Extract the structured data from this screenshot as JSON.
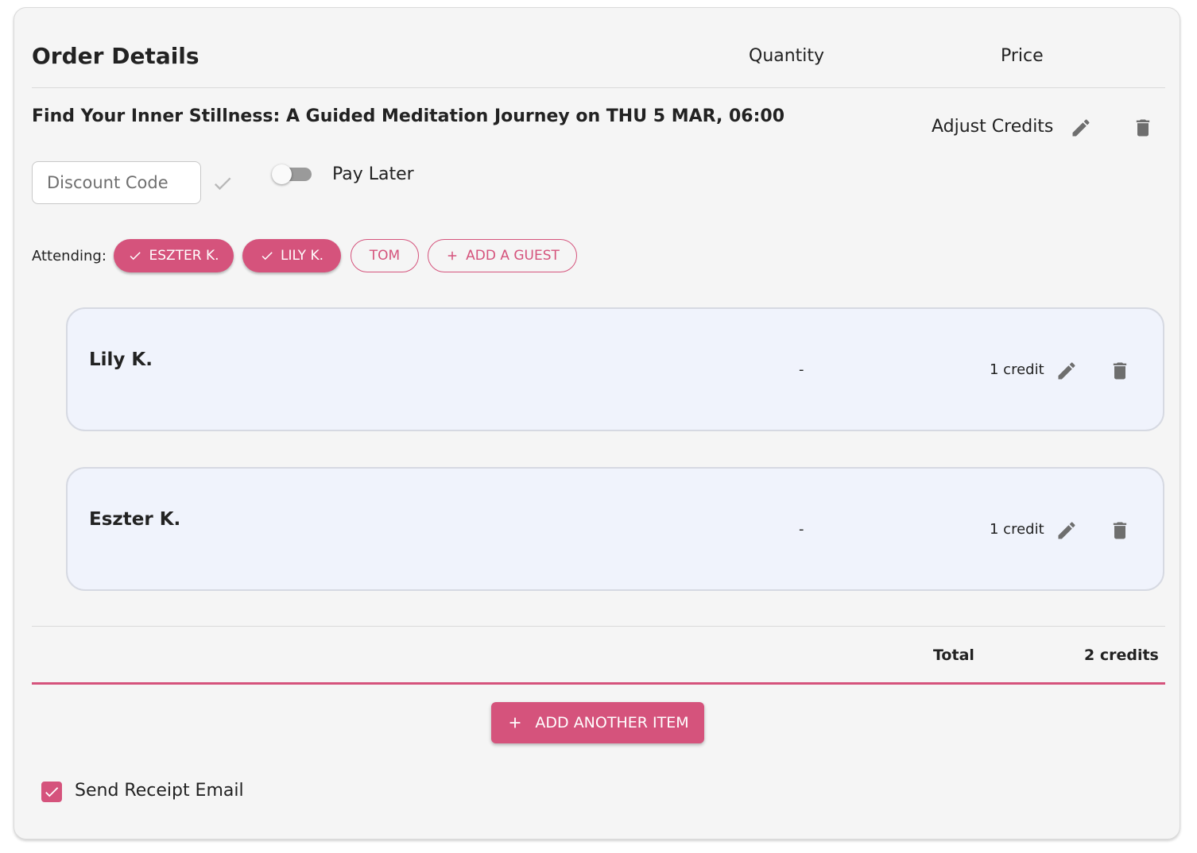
{
  "order": {
    "title": "Order Details",
    "columns": {
      "quantity": "Quantity",
      "price": "Price"
    }
  },
  "event": {
    "title": "Find Your Inner Stillness: A Guided Meditation Journey on THU 5 MAR, 06:00",
    "adjust_label": "Adjust Credits",
    "discount_placeholder": "Discount Code",
    "pay_later_label": "Pay Later",
    "pay_later_enabled": false
  },
  "attending": {
    "label": "Attending:",
    "chips": [
      {
        "label": "ESZTER K.",
        "selected": true
      },
      {
        "label": "LILY K.",
        "selected": true
      },
      {
        "label": "TOM",
        "selected": false
      }
    ],
    "add_guest_label": "ADD A GUEST"
  },
  "guests": [
    {
      "name": "Lily K.",
      "quantity": "-",
      "price": "1 credit"
    },
    {
      "name": "Eszter K.",
      "quantity": "-",
      "price": "1 credit"
    }
  ],
  "totals": {
    "label": "Total",
    "value": "2 credits"
  },
  "actions": {
    "add_item_label": "ADD ANOTHER ITEM"
  },
  "receipt": {
    "label": "Send Receipt Email",
    "checked": true
  },
  "icons": {
    "edit": "pencil-icon",
    "delete": "trash-icon",
    "apply": "check-icon",
    "add": "plus-icon"
  },
  "colors": {
    "accent": "#d5537c",
    "card_bg": "#f5f5f5",
    "guest_card_bg": "#f0f3fc",
    "icon_gray": "#6e6e6e"
  }
}
